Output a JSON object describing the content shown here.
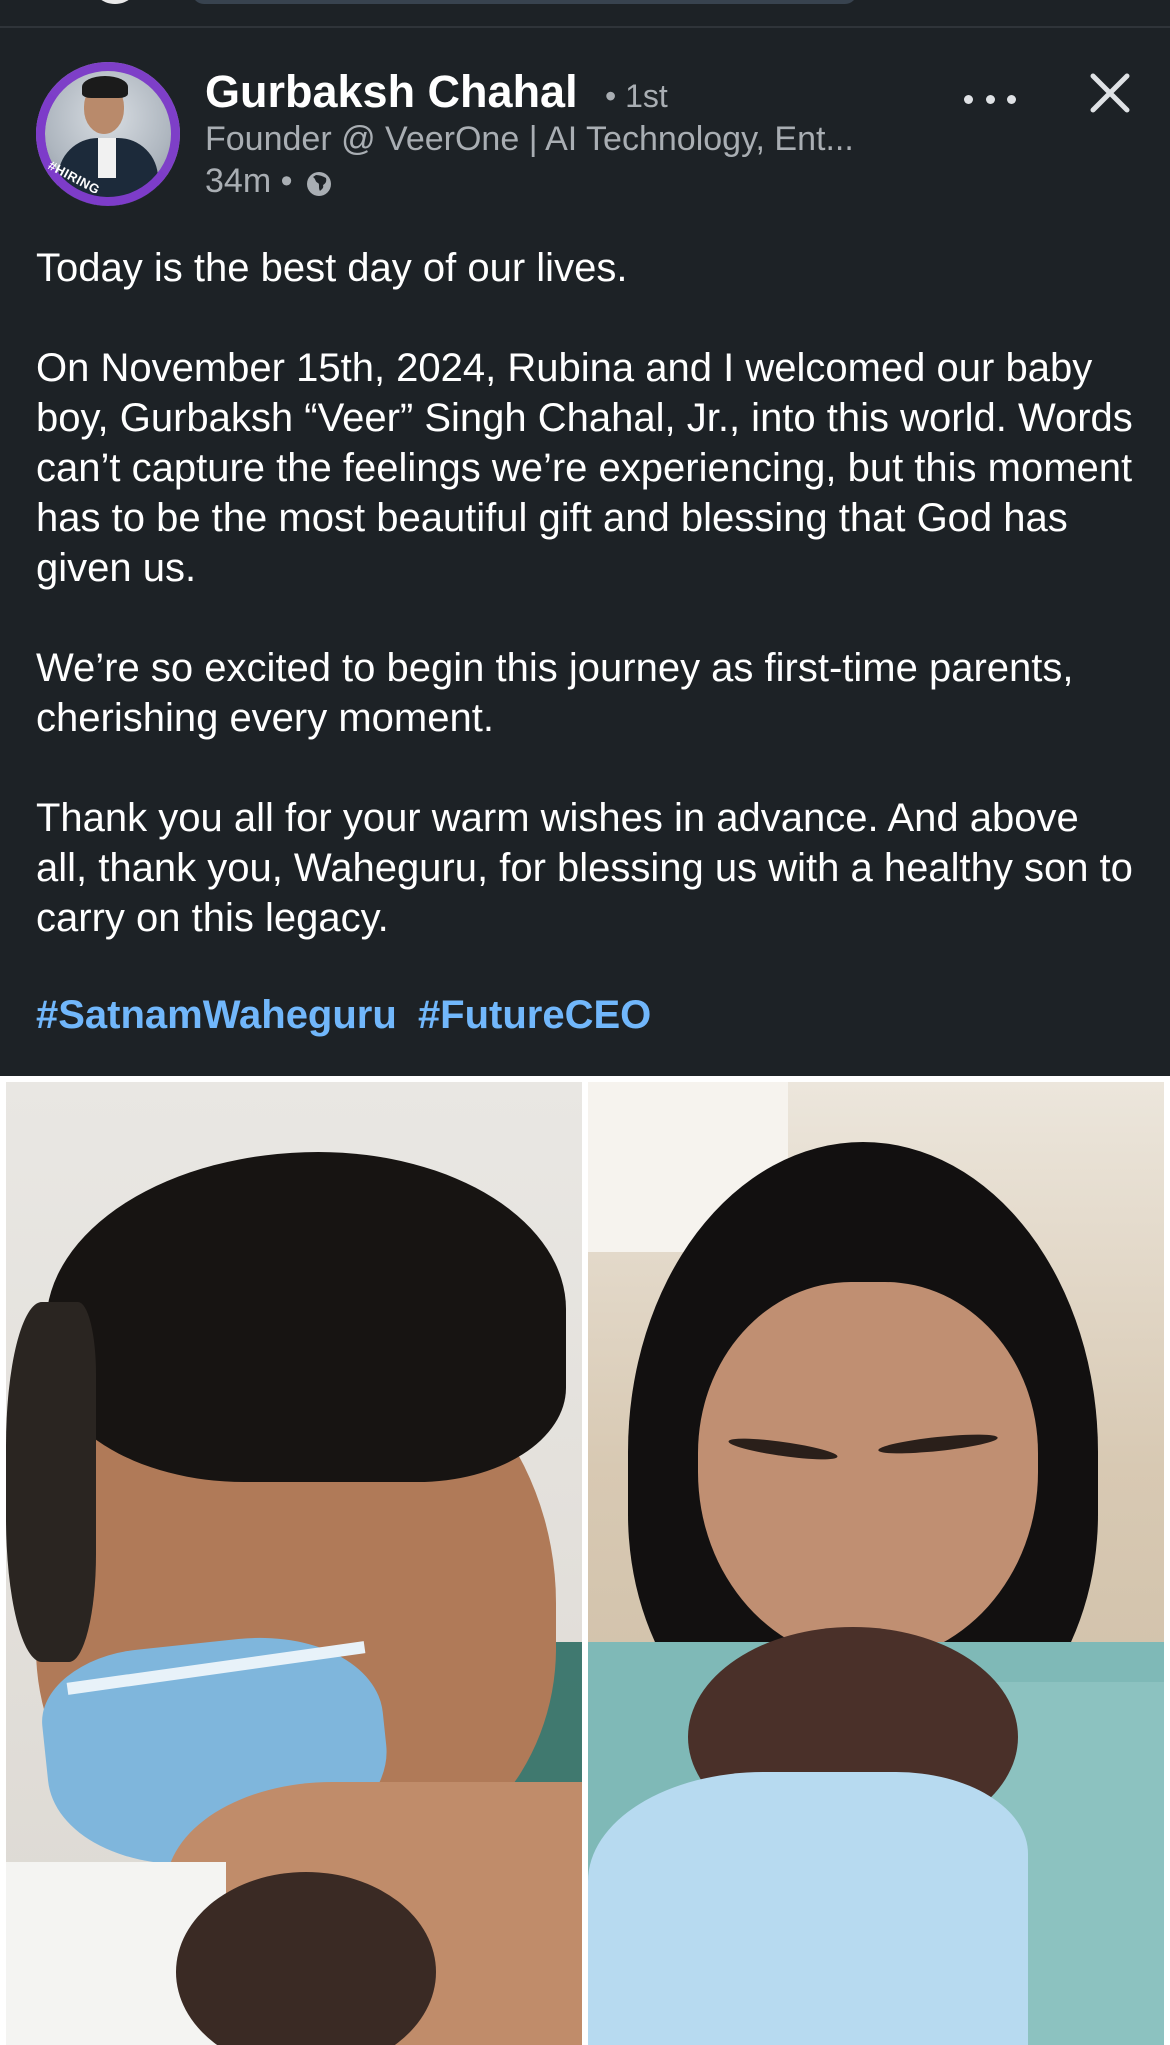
{
  "post": {
    "author": {
      "name": "Gurbaksh Chahal",
      "degree": "• 1st",
      "headline": "Founder @ VeerOne | AI Technology, Ent...",
      "time": "34m •",
      "avatar_badge": "#HIRING"
    },
    "actions": {
      "more_icon": "more-horizontal-icon",
      "close_icon": "close-icon"
    },
    "body": [
      "Today is the best day of our lives.",
      "On November 15th, 2024, Rubina and I welcomed our baby boy, Gurbaksh “Veer” Singh Chahal, Jr., into this world. Words can’t capture the feelings we’re experiencing, but this moment has to be the most beautiful gift and blessing that God has given us.",
      "We’re so excited to begin this journey as first-time parents, cherishing every moment.",
      "Thank you all for your warm wishes in advance. And above all, thank you, Waheguru, for blessing us with a healthy son to carry on this legacy."
    ],
    "hashtags": [
      "#SatnamWaheguru",
      "#FutureCEO"
    ]
  },
  "colors": {
    "background": "#1d2226",
    "text": "#ffffff",
    "muted": "#a9aeb3",
    "link": "#71b7fb",
    "avatar_ring": "#7d3cc9"
  }
}
